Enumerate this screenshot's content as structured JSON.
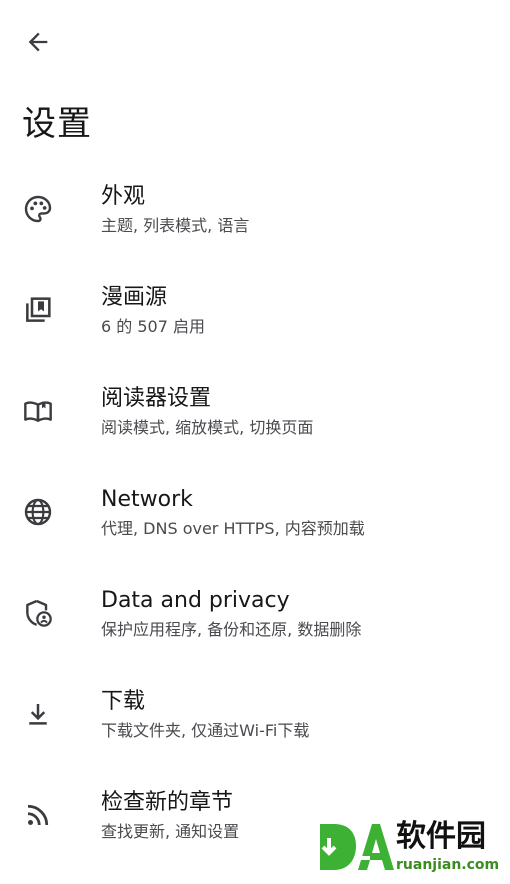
{
  "header": {
    "back_icon": "arrow-back-icon",
    "title": "设置"
  },
  "settings": {
    "items": [
      {
        "icon": "palette-icon",
        "title": "外观",
        "subtitle": "主题, 列表模式, 语言"
      },
      {
        "icon": "library-bookmark-icon",
        "title": "漫画源",
        "subtitle": "6 的 507 启用"
      },
      {
        "icon": "open-book-icon",
        "title": "阅读器设置",
        "subtitle": "阅读模式, 缩放模式, 切换页面"
      },
      {
        "icon": "globe-icon",
        "title": "Network",
        "subtitle": "代理, DNS over HTTPS, 内容预加载"
      },
      {
        "icon": "shield-person-icon",
        "title": "Data and privacy",
        "subtitle": "保护应用程序, 备份和还原, 数据删除"
      },
      {
        "icon": "download-icon",
        "title": "下载",
        "subtitle": "下载文件夹, 仅通过Wi-Fi下载"
      },
      {
        "icon": "rss-feed-icon",
        "title": "检查新的章节",
        "subtitle": "查找更新, 通知设置"
      }
    ]
  },
  "watermark": {
    "brand_cn": "软件园",
    "url": "ruanjian.com",
    "colors": {
      "green": "#3cb134",
      "dark": "#111111"
    }
  }
}
